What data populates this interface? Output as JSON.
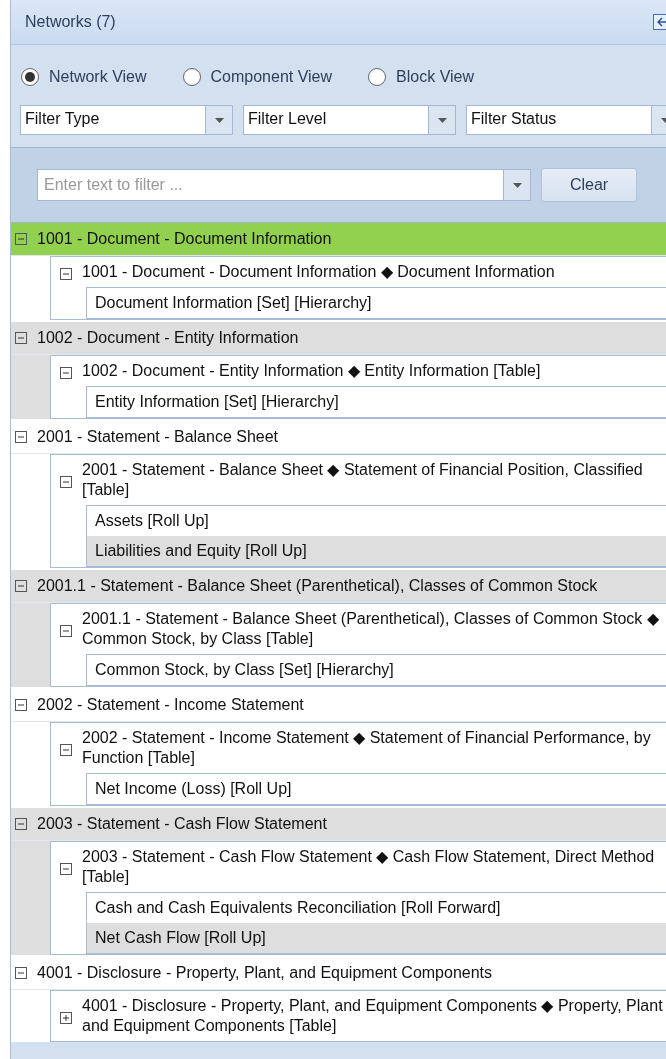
{
  "panel": {
    "title": "Networks (7)"
  },
  "views": [
    {
      "label": "Network View",
      "selected": true
    },
    {
      "label": "Component View",
      "selected": false
    },
    {
      "label": "Block View",
      "selected": false
    }
  ],
  "filters": [
    {
      "value": "Filter Type"
    },
    {
      "value": "Filter Level"
    },
    {
      "value": "Filter Status"
    }
  ],
  "search": {
    "placeholder": "Enter text to filter ...",
    "button": "Clear"
  },
  "networks": [
    {
      "label": "1001 - Document - Document Information",
      "selected": true,
      "expanded": true,
      "children": [
        {
          "label": "1001 - Document - Document Information ◆ Document Information",
          "expanded": true,
          "children": [
            {
              "label": "Document Information [Set] [Hierarchy]"
            }
          ]
        }
      ]
    },
    {
      "label": "1002 - Document - Entity Information",
      "selected": false,
      "expanded": true,
      "children": [
        {
          "label": "1002 - Document - Entity Information ◆ Entity Information [Table]",
          "expanded": true,
          "children": [
            {
              "label": "Entity Information [Set] [Hierarchy]"
            }
          ]
        }
      ]
    },
    {
      "label": "2001 - Statement - Balance Sheet",
      "selected": false,
      "expanded": true,
      "children": [
        {
          "label": "2001 - Statement - Balance Sheet ◆ Statement of Financial Position, Classified [Table]",
          "expanded": true,
          "children": [
            {
              "label": "Assets [Roll Up]"
            },
            {
              "label": "Liabilities and Equity [Roll Up]"
            }
          ]
        }
      ]
    },
    {
      "label": "2001.1 - Statement - Balance Sheet (Parenthetical), Classes of Common Stock",
      "selected": false,
      "expanded": true,
      "children": [
        {
          "label": "2001.1 - Statement - Balance Sheet (Parenthetical), Classes of Common Stock ◆ Common Stock, by Class [Table]",
          "expanded": true,
          "children": [
            {
              "label": "Common Stock, by Class [Set] [Hierarchy]"
            }
          ]
        }
      ]
    },
    {
      "label": "2002 - Statement - Income Statement",
      "selected": false,
      "expanded": true,
      "children": [
        {
          "label": "2002 - Statement - Income Statement ◆ Statement of Financial Performance, by Function [Table]",
          "expanded": true,
          "children": [
            {
              "label": "Net Income (Loss) [Roll Up]"
            }
          ]
        }
      ]
    },
    {
      "label": "2003 - Statement - Cash Flow Statement",
      "selected": false,
      "expanded": true,
      "children": [
        {
          "label": "2003 - Statement - Cash Flow Statement ◆ Cash Flow Statement, Direct Method [Table]",
          "expanded": true,
          "children": [
            {
              "label": "Cash and Cash Equivalents Reconciliation [Roll Forward]"
            },
            {
              "label": "Net Cash Flow [Roll Up]"
            }
          ]
        }
      ]
    },
    {
      "label": "4001 - Disclosure - Property, Plant, and Equipment Components",
      "selected": false,
      "expanded": true,
      "children": [
        {
          "label": "4001 - Disclosure - Property, Plant, and Equipment Components ◆ Property, Plant and Equipment Components [Table]",
          "expanded": false
        }
      ]
    }
  ]
}
